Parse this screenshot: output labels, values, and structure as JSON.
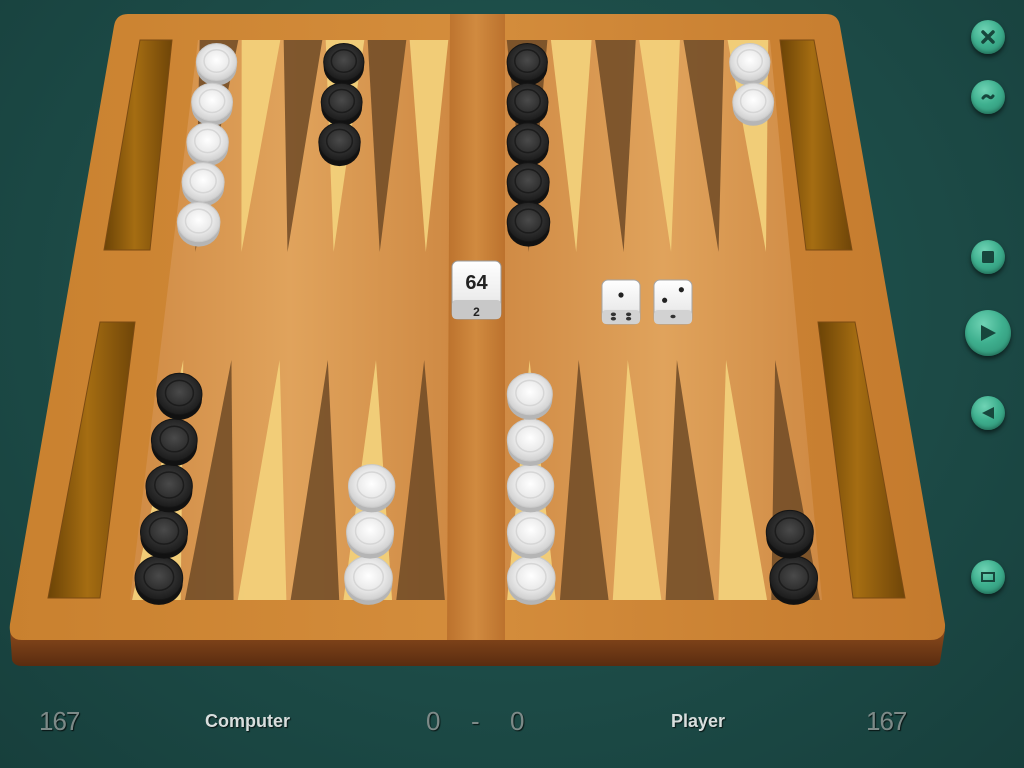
{
  "window_controls": {
    "close_icon": "close-icon",
    "minimize_icon": "minimize-icon"
  },
  "controls": [
    {
      "name": "stop-button",
      "icon": "stop-icon"
    },
    {
      "name": "play-button",
      "icon": "play-icon"
    },
    {
      "name": "back-button",
      "icon": "back-icon"
    },
    {
      "name": "window-button",
      "icon": "window-icon"
    }
  ],
  "colors": {
    "background": "#1c4a46",
    "button": "#3fb08f",
    "wood": "#c57c33",
    "point_light": "#f2d07a",
    "point_dark": "#6e4a26",
    "checker_white": "#f2f2f2",
    "checker_black": "#2b2b2b"
  },
  "doubling_cube": {
    "value": "64",
    "bottom_face": "2"
  },
  "dice": [
    {
      "value": 1,
      "side_face": 4
    },
    {
      "value": 2,
      "side_face": 1
    }
  ],
  "board": {
    "top_left": [
      {
        "point": 1,
        "color": "white",
        "count": 5
      },
      {
        "point": 4,
        "color": "black",
        "count": 3
      }
    ],
    "top_right": [
      {
        "point": 1,
        "color": "black",
        "count": 5
      },
      {
        "point": 6,
        "color": "white",
        "count": 2
      }
    ],
    "bottom_left": [
      {
        "point": 1,
        "color": "black",
        "count": 5
      },
      {
        "point": 5,
        "color": "white",
        "count": 3
      }
    ],
    "bottom_right": [
      {
        "point": 1,
        "color": "white",
        "count": 5
      },
      {
        "point": 6,
        "color": "black",
        "count": 2
      }
    ]
  },
  "footer": {
    "computer_pips": "167",
    "computer_name": "Computer",
    "score_computer": "0",
    "score_separator": "-",
    "score_player": "0",
    "player_name": "Player",
    "player_pips": "167"
  }
}
